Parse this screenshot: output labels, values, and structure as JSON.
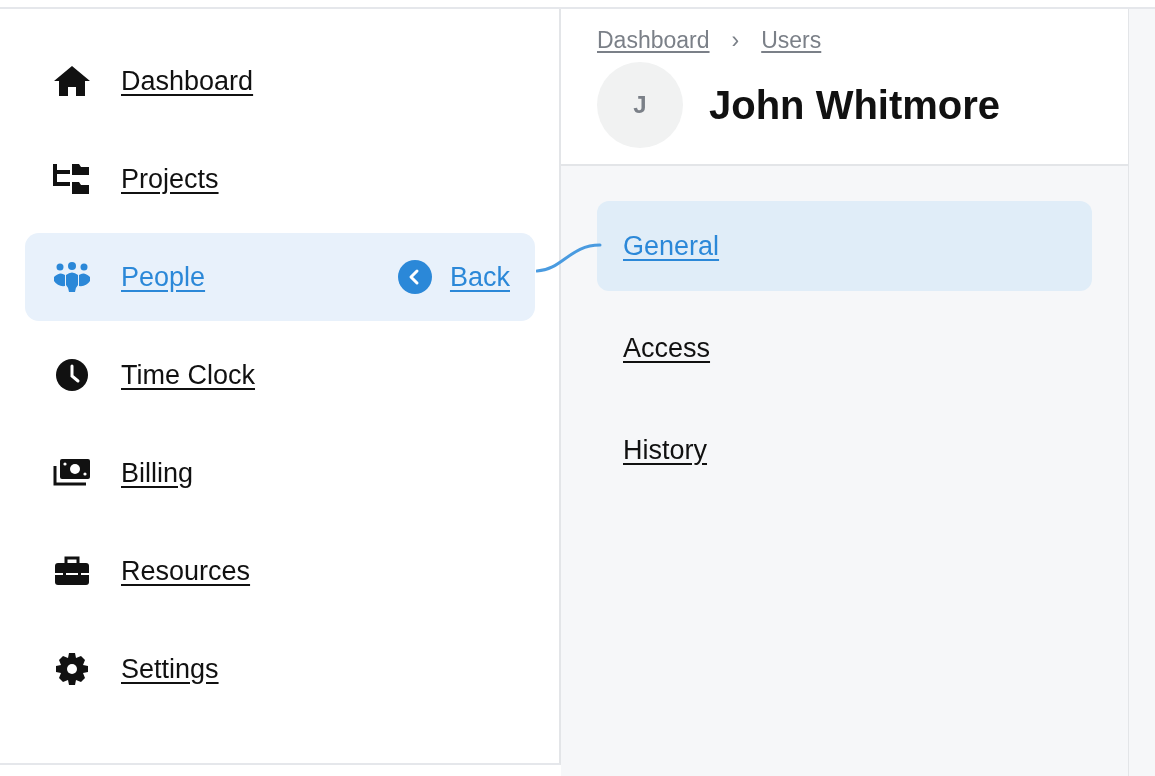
{
  "sidebar": {
    "items": [
      {
        "label": "Dashboard",
        "selected": false
      },
      {
        "label": "Projects",
        "selected": false
      },
      {
        "label": "People",
        "selected": true,
        "back": "Back"
      },
      {
        "label": "Time Clock",
        "selected": false
      },
      {
        "label": "Billing",
        "selected": false
      },
      {
        "label": "Resources",
        "selected": false
      },
      {
        "label": "Settings",
        "selected": false
      }
    ]
  },
  "header": {
    "breadcrumbs": [
      "Dashboard",
      "Users"
    ],
    "separator": "›",
    "avatar_initial": "J",
    "title": "John Whitmore"
  },
  "tabs": [
    {
      "label": "General",
      "selected": true
    },
    {
      "label": "Access",
      "selected": false
    },
    {
      "label": "History",
      "selected": false
    }
  ]
}
